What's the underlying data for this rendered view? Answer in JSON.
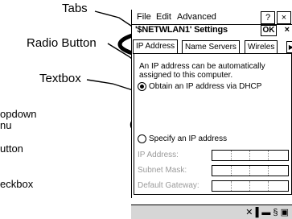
{
  "callouts": {
    "tabs": "Tabs",
    "radio_button": "Radio Button",
    "textbox": "Textbox",
    "dropdown": "opdown",
    "dropdown2": "nu",
    "button": "utton",
    "checkbox": "eckbox"
  },
  "device": {
    "menu": [
      "File",
      "Edit",
      "Advanced"
    ],
    "menu_help": "?",
    "menu_close": "×",
    "title": "'$NETWLAN1' Settings",
    "ok_label": "OK",
    "close_label": "×",
    "tabs": [
      "IP Address",
      "Name Servers",
      "Wireles"
    ],
    "tab_arrow": "▶",
    "description": "An IP address can be automatically assigned to this computer.",
    "radio_dhcp": "Obtain an IP address via DHCP",
    "radio_specify": "Specify an IP address",
    "fields": [
      "IP Address:",
      "Subnet Mask:",
      "Default Gateway:"
    ],
    "tray_icons": "✕ ▌▬ § ▣"
  }
}
